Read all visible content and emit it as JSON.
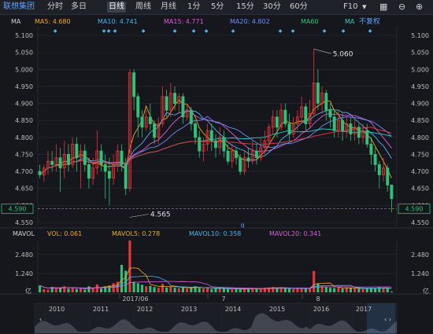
{
  "toolbar": {
    "stock_name": "联想集团",
    "periods": [
      "分时",
      "多日",
      "日线",
      "周线",
      "月线",
      "1分",
      "5分",
      "15分",
      "30分",
      "60分"
    ],
    "active_period": "日线",
    "f10": "F10"
  },
  "indicator_row": {
    "label": "MA",
    "ma5": "MA5: 4.680",
    "ma10": "MA10: 4.741",
    "ma15": "MA15: 4.771",
    "ma20": "MA20: 4.802",
    "ma60": "MA60",
    "ma_extra": "MA",
    "adjust": "不复权"
  },
  "colors": {
    "up": "#e8373a",
    "down": "#2fc27a",
    "ma5": "#f0a830",
    "ma10": "#4fb2f0",
    "ma15": "#d860d8",
    "ma20": "#6f8cff",
    "ma60": "#e23c3c",
    "ma_extra": "#3cc8c8"
  },
  "price_axis": [
    "5.100",
    "5.050",
    "5.000",
    "4.950",
    "4.900",
    "4.850",
    "4.800",
    "4.750",
    "4.700",
    "4.650",
    "4.600",
    "4.550"
  ],
  "current_price": "4.590",
  "annotations": {
    "high": "5.060",
    "low": "4.565",
    "marker": "q"
  },
  "volume_row": {
    "label": "MAVOL",
    "vol": "VOL: 0.061",
    "mavol5": "MAVOL5: 0.278",
    "mavol10": "MAVOL10: 0.358",
    "mavol20": "MAVOL20: 0.341"
  },
  "volume_axis": [
    "2.480",
    "1.240",
    "亿"
  ],
  "date_labels": [
    "2017/06",
    "7",
    "8"
  ],
  "overview_years": [
    "2010",
    "2011",
    "2012",
    "2013",
    "2014",
    "2015",
    "2016",
    "2017"
  ],
  "chart_data": {
    "type": "candlestick",
    "ylim": [
      4.55,
      5.1
    ],
    "volume_ylim": [
      0,
      3.4
    ],
    "candles": [
      [
        4.7,
        4.69,
        4.72,
        4.68
      ],
      [
        4.69,
        4.71,
        4.72,
        4.67
      ],
      [
        4.71,
        4.73,
        4.76,
        4.69
      ],
      [
        4.73,
        4.72,
        4.76,
        4.7
      ],
      [
        4.72,
        4.74,
        4.78,
        4.7
      ],
      [
        4.74,
        4.71,
        4.77,
        4.64
      ],
      [
        4.71,
        4.75,
        4.79,
        4.68
      ],
      [
        4.75,
        4.72,
        4.78,
        4.7
      ],
      [
        4.72,
        4.78,
        4.8,
        4.71
      ],
      [
        4.78,
        4.74,
        4.8,
        4.7
      ],
      [
        4.74,
        4.76,
        4.78,
        4.65
      ],
      [
        4.76,
        4.72,
        4.78,
        4.7
      ],
      [
        4.72,
        4.68,
        4.74,
        4.65
      ],
      [
        4.68,
        4.71,
        4.74,
        4.66
      ],
      [
        4.71,
        4.76,
        4.82,
        4.69
      ],
      [
        4.76,
        4.72,
        4.78,
        4.7
      ],
      [
        4.72,
        4.7,
        4.75,
        4.62
      ],
      [
        4.7,
        4.68,
        4.74,
        4.6
      ],
      [
        4.68,
        4.72,
        4.75,
        4.66
      ],
      [
        4.72,
        4.76,
        4.78,
        4.7
      ],
      [
        4.76,
        4.72,
        4.78,
        4.7
      ],
      [
        4.72,
        4.65,
        4.74,
        4.63
      ],
      [
        4.65,
        4.99,
        5.0,
        4.64
      ],
      [
        4.99,
        4.92,
        5.0,
        4.88
      ],
      [
        4.92,
        4.86,
        4.93,
        4.8
      ],
      [
        4.86,
        4.83,
        4.88,
        4.8
      ],
      [
        4.83,
        4.86,
        4.88,
        4.82
      ],
      [
        4.86,
        4.84,
        4.9,
        4.82
      ],
      [
        4.84,
        4.8,
        4.85,
        4.78
      ],
      [
        4.8,
        4.84,
        4.86,
        4.78
      ],
      [
        4.84,
        4.92,
        4.95,
        4.83
      ],
      [
        4.92,
        4.88,
        4.94,
        4.86
      ],
      [
        4.88,
        4.93,
        4.96,
        4.86
      ],
      [
        4.93,
        4.9,
        4.95,
        4.88
      ],
      [
        4.9,
        4.92,
        4.93,
        4.87
      ],
      [
        4.92,
        4.86,
        4.93,
        4.84
      ],
      [
        4.86,
        4.88,
        4.9,
        4.85
      ],
      [
        4.88,
        4.84,
        4.89,
        4.82
      ],
      [
        4.84,
        4.8,
        4.85,
        4.78
      ],
      [
        4.8,
        4.76,
        4.82,
        4.74
      ],
      [
        4.76,
        4.78,
        4.8,
        4.73
      ],
      [
        4.78,
        4.82,
        4.84,
        4.76
      ],
      [
        4.82,
        4.79,
        4.84,
        4.76
      ],
      [
        4.79,
        4.77,
        4.81,
        4.74
      ],
      [
        4.77,
        4.8,
        4.83,
        4.75
      ],
      [
        4.8,
        4.76,
        4.82,
        4.74
      ],
      [
        4.76,
        4.73,
        4.78,
        4.72
      ],
      [
        4.73,
        4.76,
        4.78,
        4.71
      ],
      [
        4.76,
        4.74,
        4.77,
        4.72
      ],
      [
        4.74,
        4.7,
        4.75,
        4.69
      ],
      [
        4.7,
        4.74,
        4.76,
        4.69
      ],
      [
        4.74,
        4.73,
        4.77,
        4.71
      ],
      [
        4.73,
        4.76,
        4.79,
        4.72
      ],
      [
        4.76,
        4.74,
        4.78,
        4.72
      ],
      [
        4.74,
        4.77,
        4.8,
        4.73
      ],
      [
        4.77,
        4.79,
        4.82,
        4.75
      ],
      [
        4.79,
        4.83,
        4.84,
        4.77
      ],
      [
        4.83,
        4.86,
        4.88,
        4.81
      ],
      [
        4.86,
        4.83,
        4.88,
        4.8
      ],
      [
        4.83,
        4.88,
        4.9,
        4.82
      ],
      [
        4.88,
        4.84,
        4.9,
        4.83
      ],
      [
        4.84,
        4.81,
        4.87,
        4.79
      ],
      [
        4.81,
        4.84,
        4.86,
        4.8
      ],
      [
        4.84,
        4.86,
        4.88,
        4.82
      ],
      [
        4.86,
        4.89,
        4.92,
        4.84
      ],
      [
        4.89,
        4.84,
        4.9,
        4.82
      ],
      [
        4.84,
        4.87,
        4.91,
        4.83
      ],
      [
        4.87,
        4.96,
        5.06,
        4.86
      ],
      [
        4.96,
        4.9,
        5.0,
        4.88
      ],
      [
        4.9,
        4.93,
        4.95,
        4.87
      ],
      [
        4.93,
        4.88,
        4.94,
        4.85
      ],
      [
        4.88,
        4.86,
        4.9,
        4.83
      ],
      [
        4.86,
        4.82,
        4.88,
        4.8
      ],
      [
        4.82,
        4.85,
        4.88,
        4.8
      ],
      [
        4.85,
        4.82,
        4.87,
        4.79
      ],
      [
        4.82,
        4.84,
        4.86,
        4.8
      ],
      [
        4.84,
        4.81,
        4.86,
        4.79
      ],
      [
        4.81,
        4.83,
        4.85,
        4.79
      ],
      [
        4.83,
        4.8,
        4.84,
        4.78
      ],
      [
        4.8,
        4.82,
        4.84,
        4.78
      ],
      [
        4.82,
        4.78,
        4.84,
        4.77
      ],
      [
        4.78,
        4.75,
        4.8,
        4.72
      ],
      [
        4.75,
        4.72,
        4.77,
        4.7
      ],
      [
        4.72,
        4.69,
        4.73,
        4.65
      ],
      [
        4.69,
        4.71,
        4.74,
        4.67
      ],
      [
        4.71,
        4.66,
        4.72,
        4.64
      ],
      [
        4.66,
        4.62,
        4.66,
        4.58
      ]
    ],
    "volume": [
      0.45,
      0.22,
      0.18,
      0.35,
      0.28,
      0.31,
      0.4,
      0.25,
      0.3,
      0.22,
      0.26,
      0.18,
      0.4,
      0.3,
      0.52,
      0.26,
      0.38,
      0.45,
      0.6,
      0.7,
      1.8,
      1.42,
      3.4,
      0.7,
      0.6,
      0.5,
      0.4,
      0.42,
      0.35,
      0.3,
      0.55,
      0.32,
      0.36,
      0.3,
      0.28,
      0.34,
      0.26,
      0.32,
      0.4,
      0.28,
      0.25,
      0.3,
      0.22,
      0.24,
      0.28,
      0.26,
      0.22,
      0.2,
      0.24,
      0.22,
      0.2,
      0.25,
      0.28,
      0.24,
      0.26,
      0.3,
      0.32,
      0.35,
      0.3,
      0.28,
      0.26,
      0.24,
      0.22,
      0.28,
      0.3,
      0.26,
      0.28,
      1.4,
      0.6,
      0.42,
      0.35,
      0.3,
      0.28,
      0.32,
      0.26,
      0.3,
      0.28,
      0.26,
      0.24,
      0.22,
      0.26,
      0.3,
      0.28,
      0.34,
      0.3,
      0.26,
      0.06
    ]
  }
}
